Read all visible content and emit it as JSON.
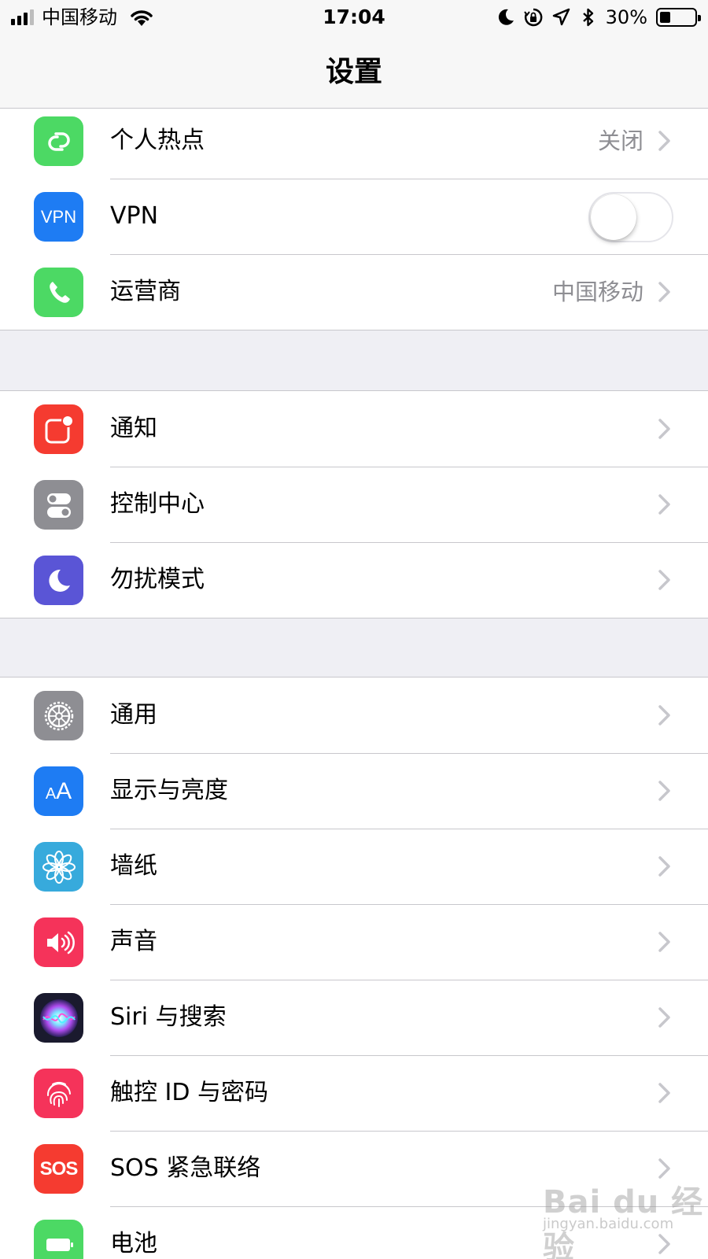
{
  "status_bar": {
    "carrier": "中国移动",
    "time": "17:04",
    "battery_percent": "30%",
    "battery_level": 0.3,
    "icons": [
      "signal-icon",
      "wifi-icon",
      "moon-icon",
      "rotation-lock-icon",
      "location-icon",
      "bluetooth-icon",
      "battery-icon"
    ]
  },
  "nav": {
    "title": "设置"
  },
  "colors": {
    "hotspot": "#4cd964",
    "vpn": "#1e7cf3",
    "carrier": "#4cd964",
    "notifications": "#f53b30",
    "control_center": "#8e8e93",
    "dnd": "#5a55d6",
    "general": "#8e8e93",
    "display": "#1e7cf3",
    "wallpaper": "#37aadc",
    "sounds": "#f5335a",
    "siri": "#1a1a2e",
    "touch_id": "#f5335a",
    "sos": "#f53b30",
    "battery": "#4cd964"
  },
  "groups": [
    {
      "items": [
        {
          "label": "个人热点",
          "value": "关闭",
          "icon": "hotspot-icon"
        },
        {
          "label": "VPN",
          "icon_text": "VPN",
          "icon": "vpn-icon",
          "toggle": false
        },
        {
          "label": "运营商",
          "value": "中国移动",
          "icon": "phone-icon"
        }
      ]
    },
    {
      "items": [
        {
          "label": "通知",
          "icon": "notifications-icon"
        },
        {
          "label": "控制中心",
          "icon": "control-center-icon"
        },
        {
          "label": "勿扰模式",
          "icon": "moon-icon"
        }
      ]
    },
    {
      "items": [
        {
          "label": "通用",
          "icon": "gear-icon"
        },
        {
          "label": "显示与亮度",
          "icon_text": "AA",
          "icon": "display-brightness-icon"
        },
        {
          "label": "墙纸",
          "icon": "flower-icon"
        },
        {
          "label": "声音",
          "icon": "speaker-icon"
        },
        {
          "label": "Siri 与搜索",
          "icon": "siri-icon"
        },
        {
          "label": "触控 ID 与密码",
          "icon": "fingerprint-icon"
        },
        {
          "label": "SOS 紧急联络",
          "icon_text": "SOS",
          "icon": "sos-icon"
        },
        {
          "label": "电池",
          "icon": "battery-icon"
        }
      ]
    }
  ],
  "watermark": {
    "brand": "Bai du 经验",
    "url": "jingyan.baidu.com"
  }
}
